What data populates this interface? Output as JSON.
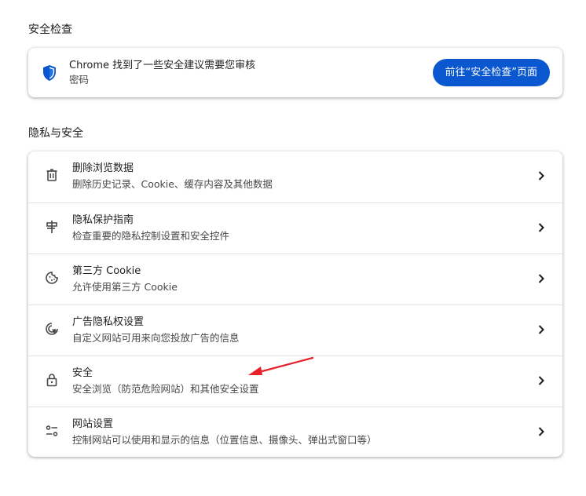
{
  "safety_check": {
    "section_title": "安全检查",
    "title": "Chrome 找到了一些安全建议需要您审核",
    "subtitle": "密码",
    "button_label": "前往“安全检查”页面",
    "icon": "shield-icon"
  },
  "privacy": {
    "section_title": "隐私与安全",
    "items": [
      {
        "title": "删除浏览数据",
        "subtitle": "删除历史记录、Cookie、缓存内容及其他数据",
        "icon": "trash-icon"
      },
      {
        "title": "隐私保护指南",
        "subtitle": "检查重要的隐私控制设置和安全控件",
        "icon": "privacy-guide-icon"
      },
      {
        "title": "第三方 Cookie",
        "subtitle": "允许使用第三方 Cookie",
        "icon": "cookie-icon"
      },
      {
        "title": "广告隐私权设置",
        "subtitle": "自定义网站可用来向您投放广告的信息",
        "icon": "ad-privacy-icon"
      },
      {
        "title": "安全",
        "subtitle": "安全浏览（防范危险网站）和其他安全设置",
        "icon": "lock-icon"
      },
      {
        "title": "网站设置",
        "subtitle": "控制网站可以使用和显示的信息（位置信息、摄像头、弹出式窗口等）",
        "icon": "site-settings-icon"
      }
    ]
  },
  "colors": {
    "accent": "#0b57d0",
    "annotation_arrow": "#e8202a",
    "icon_gray": "#474747"
  }
}
